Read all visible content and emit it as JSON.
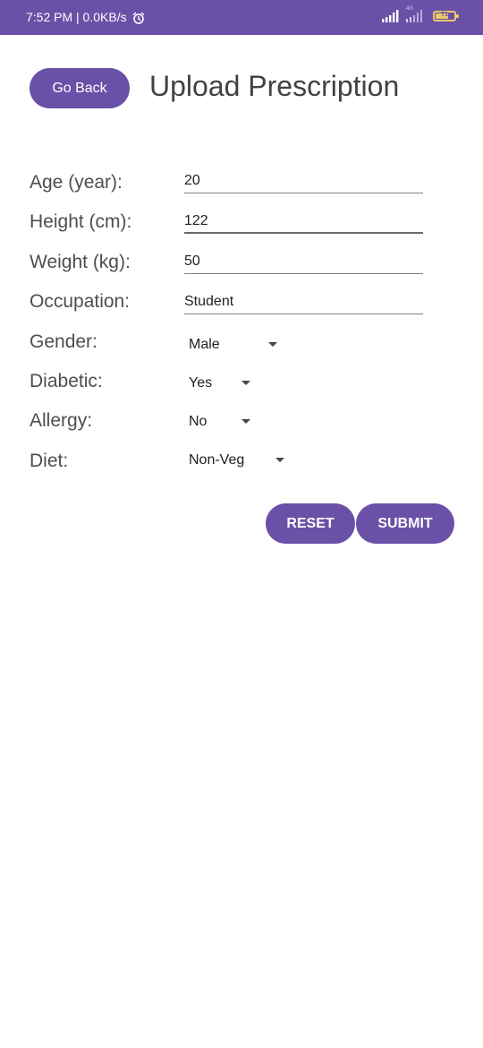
{
  "status_bar": {
    "time_and_speed": "7:52 PM | 0.0KB/s",
    "network_type": "4G",
    "battery_level": "71",
    "battery_fraction": 0.71,
    "background_color": "#6a50a7"
  },
  "header": {
    "back_label": "Go Back",
    "title": "Upload Prescription"
  },
  "form": {
    "age": {
      "label": "Age (year):",
      "value": "20"
    },
    "height": {
      "label": "Height (cm):",
      "value": "122"
    },
    "weight": {
      "label": "Weight (kg):",
      "value": "50"
    },
    "occupation": {
      "label": "Occupation:",
      "value": "Student"
    },
    "gender": {
      "label": "Gender:",
      "selected": "Male"
    },
    "diabetic": {
      "label": "Diabetic:",
      "selected": "Yes"
    },
    "allergy": {
      "label": "Allergy:",
      "selected": "No"
    },
    "diet": {
      "label": "Diet:",
      "selected": "Non-Veg"
    }
  },
  "actions": {
    "reset_label": "RESET",
    "submit_label": "SUBMIT"
  },
  "theme": {
    "accent": "#6a50a7",
    "icons": [
      "alarm-icon",
      "signal-icon",
      "battery-icon",
      "caret-down-icon"
    ]
  }
}
